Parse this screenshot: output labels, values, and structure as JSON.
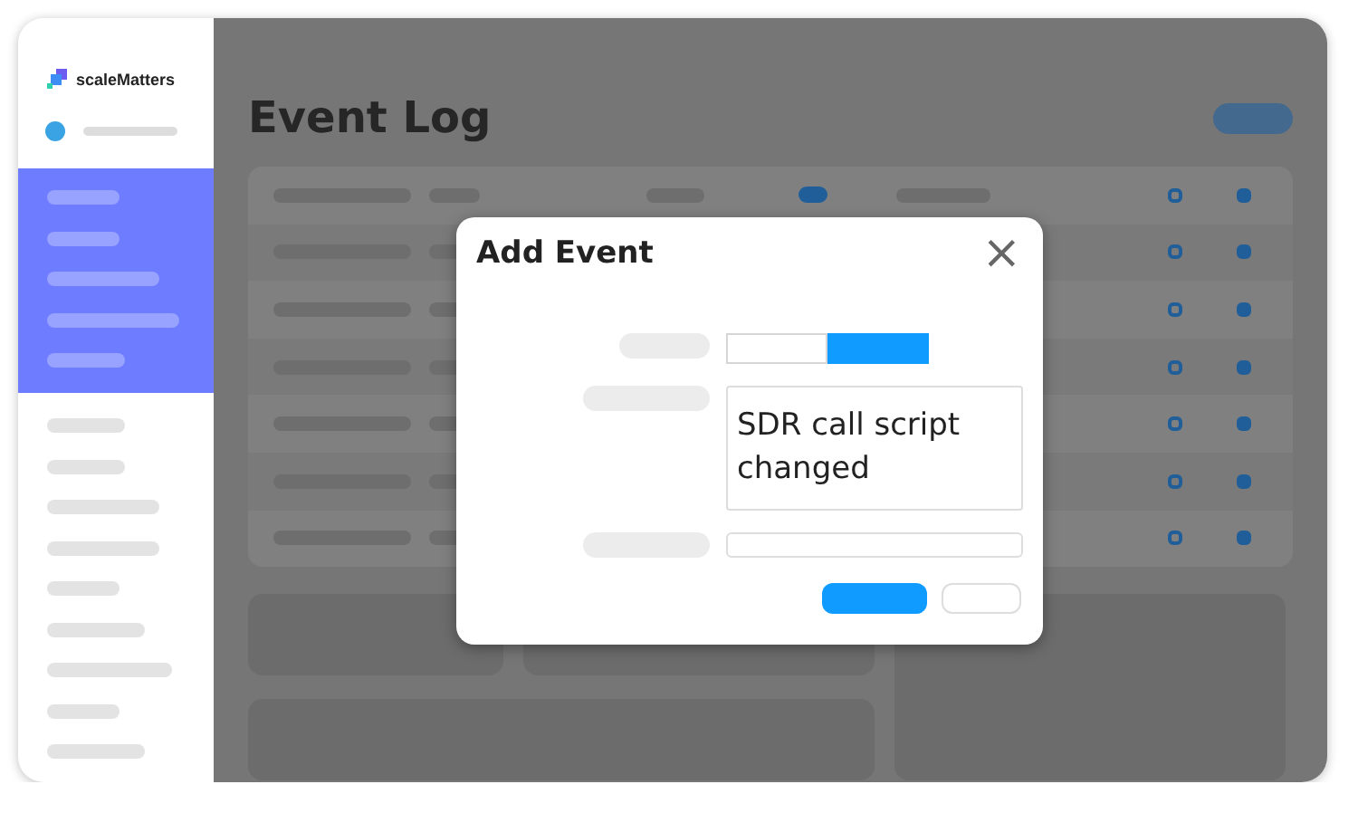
{
  "brand": {
    "name": "scaleMatters"
  },
  "page": {
    "title": "Event Log"
  },
  "dialog": {
    "title": "Add Event",
    "close": "×",
    "toggle": [
      {
        "selected": false
      },
      {
        "selected": true
      }
    ],
    "description": {
      "value": "SDR call script changed"
    }
  }
}
